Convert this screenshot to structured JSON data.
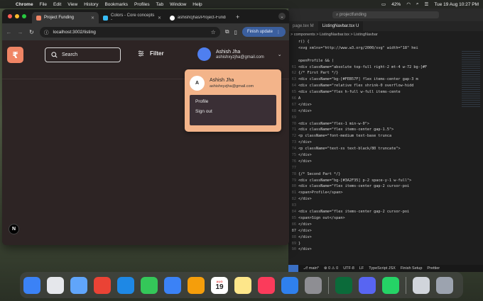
{
  "menubar": {
    "app": "Chrome",
    "items": [
      "File",
      "Edit",
      "View",
      "History",
      "Bookmarks",
      "Profiles",
      "Tab",
      "Window",
      "Help"
    ],
    "battery": "42%",
    "datetime": "Tue 19 Aug 10:27 PM"
  },
  "browser": {
    "tabs": [
      {
        "label": "Project Funding",
        "color": "#F08565"
      },
      {
        "label": "Colors - Core concepts -",
        "color": "#38bdf8"
      },
      {
        "label": "ashishcjhas/Project-Fundi",
        "color": "#ffffff"
      }
    ],
    "url": "localhost:3002/listing",
    "finish_update": "Finish update"
  },
  "page": {
    "logo_glyph": "₹",
    "search_placeholder": "Search",
    "filter_label": "Filter",
    "user": {
      "name": "Ashish Jha",
      "email": "ashishxyzjha@gmail.com"
    },
    "dropdown": {
      "avatar_initial": "A",
      "name": "Ashish Jha",
      "email": "ashishxyzjha@gmail.com",
      "items": [
        "Profile",
        "Sign out"
      ],
      "colors": {
        "top": "#F3B48A",
        "bottom": "#3A2F35"
      }
    },
    "badge": "N"
  },
  "editor": {
    "search": "projectfunding",
    "tabs": [
      "page.tex M",
      "ListingNavbar.tsx U"
    ],
    "breadcrumb": "> components > ListingNavbar.tsx > ListingNavbar",
    "lines": [
      {
        "n": "",
        "t": "r() {"
      },
      {
        "n": "",
        "t": "    <svg xmlns=\"http://www.w3.org/2000/svg\" width=\"18\" hei"
      },
      {
        "n": "",
        "t": ""
      },
      {
        "n": "",
        "t": "openProfile && ("
      },
      {
        "n": "61",
        "t": "  <div className=\"absolute top-full right-2 mt-4 w-72 bg-[#F"
      },
      {
        "n": "62",
        "t": "    {/* First Part */}"
      },
      {
        "n": "63",
        "t": "    <div className=\"bg-[#FEB57F] flex items-center gap-3 m"
      },
      {
        "n": "64",
        "t": "      <div className=\"relative flex shrink-0 overflow-hidd"
      },
      {
        "n": "65",
        "t": "        <div className=\"flex h-full w-full items-cente"
      },
      {
        "n": "66",
        "t": "          A"
      },
      {
        "n": "67",
        "t": "        </div>"
      },
      {
        "n": "68",
        "t": "      </div>"
      },
      {
        "n": "69",
        "t": ""
      },
      {
        "n": "70",
        "t": "      <div className=\"flex-1 min-w-0\">"
      },
      {
        "n": "71",
        "t": "        <div className=\"flex items-center gap-1.5\">"
      },
      {
        "n": "72",
        "t": "          <p className=\"font-medium text-base trunca"
      },
      {
        "n": "73",
        "t": "        </div>"
      },
      {
        "n": "74",
        "t": "        <p className=\"text-xs text-black/80 truncate\">"
      },
      {
        "n": "75",
        "t": "      </div>"
      },
      {
        "n": "76",
        "t": "    </div>"
      },
      {
        "n": "77",
        "t": ""
      },
      {
        "n": "78",
        "t": "    {/* Second Part */}"
      },
      {
        "n": "79",
        "t": "    <div className=\"bg-[#3A2F35] p-2 space-y-1 w-full\">"
      },
      {
        "n": "80",
        "t": "      <div className=\"flex items-center gap-2 cursor-poi"
      },
      {
        "n": "81",
        "t": "        <span>Profile</span>"
      },
      {
        "n": "82",
        "t": "      </div>"
      },
      {
        "n": "83",
        "t": ""
      },
      {
        "n": "84",
        "t": "      <div className=\"flex items-center gap-2 cursor-poi"
      },
      {
        "n": "85",
        "t": "        <span>Sign out</span>"
      },
      {
        "n": "86",
        "t": "      </div>"
      },
      {
        "n": "87",
        "t": "    </div>"
      },
      {
        "n": "88",
        "t": "  </div>"
      },
      {
        "n": "89",
        "t": "}"
      },
      {
        "n": "90",
        "t": "</div>"
      }
    ],
    "status": {
      "branch": "main*",
      "errors": "0",
      "warnings": "0",
      "encoding": "UTF-8",
      "eol": "LF",
      "lang": "TypeScript JSX",
      "finish": "Finish Setup",
      "prettier": "Prettier"
    }
  },
  "dock": {
    "apps": [
      {
        "name": "Finder",
        "color": "#3b82f6"
      },
      {
        "name": "Launchpad",
        "color": "#e5e7eb"
      },
      {
        "name": "Safari",
        "color": "#60a5fa"
      },
      {
        "name": "Chrome",
        "color": "#ea4335"
      },
      {
        "name": "VS Code",
        "color": "#1e88e5"
      },
      {
        "name": "Messages",
        "color": "#34c759"
      },
      {
        "name": "Mail",
        "color": "#3b82f6"
      },
      {
        "name": "Photos",
        "color": "#f59e0b"
      },
      {
        "name": "Calendar",
        "color": "#ffffff"
      },
      {
        "name": "Notes",
        "color": "#fde68a"
      },
      {
        "name": "Music",
        "color": "#fb3b5b"
      },
      {
        "name": "App Store",
        "color": "#2f80ed"
      },
      {
        "name": "System Settings",
        "color": "#8e8e93"
      },
      {
        "name": "MongoDB Compass",
        "color": "#0b6b3a"
      },
      {
        "name": "Discord",
        "color": "#5865f2"
      },
      {
        "name": "WhatsApp",
        "color": "#25d366"
      },
      {
        "name": "Screenshot",
        "color": "#d1d5db"
      },
      {
        "name": "Trash",
        "color": "#9ca3af"
      }
    ],
    "calendar": {
      "month": "AUG",
      "day": "19"
    }
  }
}
